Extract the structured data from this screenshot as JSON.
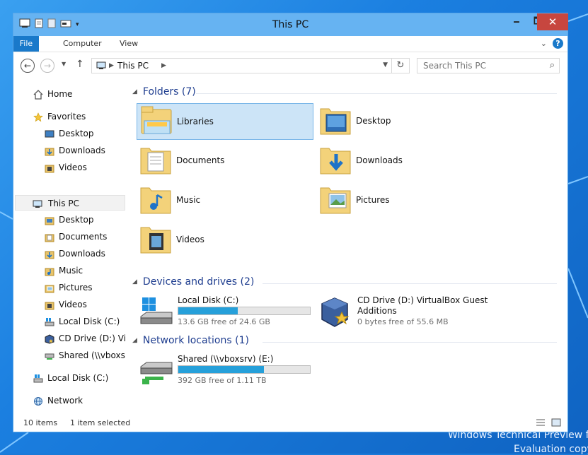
{
  "window": {
    "title": "This PC",
    "min_glyph": "🗕",
    "max_glyph": "🗖",
    "close_glyph": "✕"
  },
  "ribbon": {
    "tabs": [
      "File",
      "Computer",
      "View"
    ],
    "collapse_glyph": "⌄",
    "help_glyph": "?"
  },
  "navigation": {
    "back_glyph": "←",
    "forward_glyph": "→",
    "recent_glyph": "▼",
    "up_glyph": "↑",
    "address": "This PC",
    "refresh_glyph": "↻"
  },
  "search": {
    "placeholder": "Search This PC",
    "icon_glyph": "⌕"
  },
  "sidebar": {
    "items": [
      {
        "label": "Home",
        "icon": "home-icon"
      },
      {
        "label": "Favorites",
        "icon": "star-icon"
      },
      {
        "label": "Desktop",
        "icon": "desktop-icon"
      },
      {
        "label": "Downloads",
        "icon": "downloads-icon"
      },
      {
        "label": "Videos",
        "icon": "videos-icon"
      },
      {
        "label": "This PC",
        "icon": "computer-icon"
      },
      {
        "label": "Desktop",
        "icon": "desktop-icon"
      },
      {
        "label": "Documents",
        "icon": "documents-icon"
      },
      {
        "label": "Downloads",
        "icon": "downloads-icon"
      },
      {
        "label": "Music",
        "icon": "music-icon"
      },
      {
        "label": "Pictures",
        "icon": "pictures-icon"
      },
      {
        "label": "Videos",
        "icon": "videos-icon"
      },
      {
        "label": "Local Disk (C:)",
        "icon": "drive-icon"
      },
      {
        "label": "CD Drive (D:) VirtualBox Guest Additions",
        "icon": "cd-icon"
      },
      {
        "label": "Shared (\\\\vboxsrv) (E:)",
        "icon": "network-drive-icon"
      },
      {
        "label": "Local Disk (C:)",
        "icon": "drive-icon"
      },
      {
        "label": "Network",
        "icon": "network-icon"
      }
    ]
  },
  "content": {
    "groups": {
      "folders": "Folders (7)",
      "devices": "Devices and drives (2)",
      "network": "Network locations (1)"
    },
    "folders": [
      "Libraries",
      "Desktop",
      "Documents",
      "Downloads",
      "Music",
      "Pictures",
      "Videos"
    ],
    "drives": [
      {
        "name": "Local Disk (C:)",
        "free": "13.6 GB free of 24.6 GB",
        "used_fraction": 0.45
      },
      {
        "name": "CD Drive (D:) VirtualBox Guest",
        "name2": "Additions",
        "free": "0 bytes free of 55.6 MB"
      }
    ],
    "network": [
      {
        "name": "Shared (\\\\vboxsrv) (E:)",
        "free": "392 GB free of 1.11 TB",
        "used_fraction": 0.65
      }
    ]
  },
  "status": {
    "items": "10 items",
    "selected": "1 item selected"
  },
  "desktop": {
    "watermark_line1": "Windows Technical Preview fo",
    "watermark_line2": "Evaluation copy"
  },
  "colors": {
    "titlebar": "#66b3f2",
    "file_tab": "#1979ca",
    "close": "#c7463f",
    "selection": "#cce4f7",
    "bar_fill": "#26a0da",
    "group_header": "#1e3d8f"
  }
}
